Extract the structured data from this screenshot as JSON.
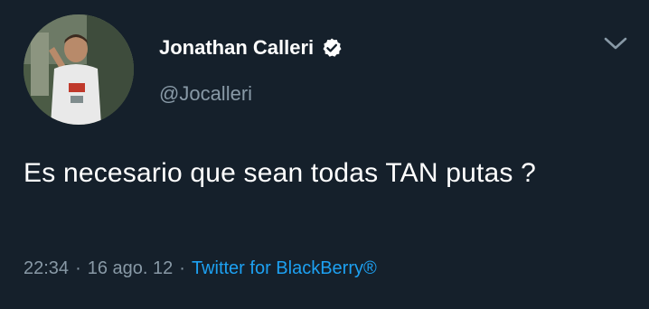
{
  "user": {
    "display_name": "Jonathan Calleri",
    "handle": "@Jocalleri",
    "verified": true,
    "avatar_icon": "profile-photo"
  },
  "tweet": {
    "text": "Es necesario que sean todas TAN putas ?",
    "time": "22:34",
    "date": "16 ago. 12",
    "source": "Twitter for BlackBerry®",
    "separator": "·"
  },
  "icons": {
    "verified": "verified-badge-icon",
    "menu": "chevron-down-icon"
  },
  "colors": {
    "background": "#15202b",
    "text_primary": "#ffffff",
    "text_secondary": "#8899a6",
    "link": "#1da1f2"
  }
}
